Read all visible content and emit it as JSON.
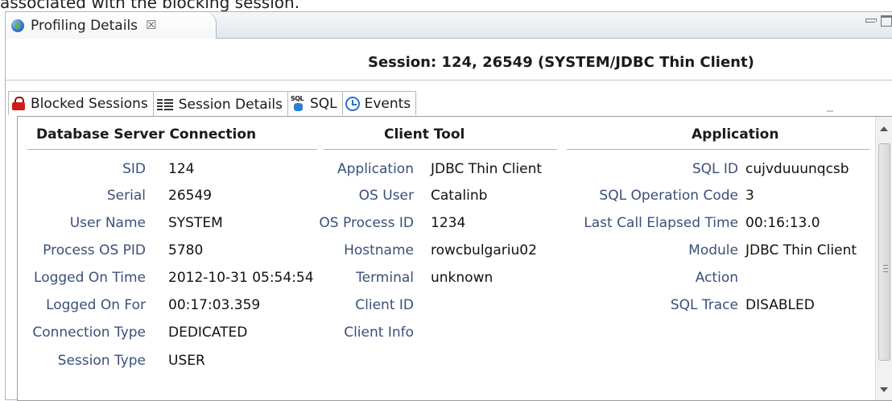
{
  "caption": "associated with the blocking session.",
  "view": {
    "tab_label": "Profiling Details",
    "close_glyph": "☒"
  },
  "session_title": "Session: 124, 26549 (SYSTEM/JDBC Thin Client)",
  "subtabs": [
    {
      "label": "Blocked Sessions",
      "icon": "lock-icon"
    },
    {
      "label": "Session Details",
      "icon": "list-icon",
      "active": true
    },
    {
      "label": "SQL",
      "icon": "sql-icon"
    },
    {
      "label": "Events",
      "icon": "events-icon"
    }
  ],
  "sections": {
    "database": {
      "header": "Database Server Connection",
      "rows": [
        {
          "label": "SID",
          "value": "124"
        },
        {
          "label": "Serial",
          "value": "26549"
        },
        {
          "label": "User Name",
          "value": "SYSTEM"
        },
        {
          "label": "Process OS PID",
          "value": "5780"
        },
        {
          "label": "Logged On Time",
          "value": "2012-10-31 05:54:54"
        },
        {
          "label": "Logged On For",
          "value": "00:17:03.359"
        },
        {
          "label": "Connection Type",
          "value": "DEDICATED"
        },
        {
          "label": "Session Type",
          "value": "USER"
        }
      ]
    },
    "client": {
      "header": "Client Tool",
      "rows": [
        {
          "label": "Application",
          "value": "JDBC Thin Client"
        },
        {
          "label": "OS User",
          "value": "Catalinb"
        },
        {
          "label": "OS Process ID",
          "value": "1234"
        },
        {
          "label": "Hostname",
          "value": "rowcbulgariu02"
        },
        {
          "label": "Terminal",
          "value": "unknown"
        },
        {
          "label": "Client ID",
          "value": ""
        },
        {
          "label": "Client Info",
          "value": ""
        }
      ]
    },
    "application": {
      "header": "Application",
      "rows": [
        {
          "label": "SQL ID",
          "value": "cujvduuunqcsb"
        },
        {
          "label": "SQL Operation Code",
          "value": "3"
        },
        {
          "label": "Last Call Elapsed Time",
          "value": "00:16:13.0"
        },
        {
          "label": "Module",
          "value": "JDBC Thin Client"
        },
        {
          "label": "Action",
          "value": ""
        },
        {
          "label": "SQL Trace",
          "value": "DISABLED"
        }
      ]
    }
  }
}
